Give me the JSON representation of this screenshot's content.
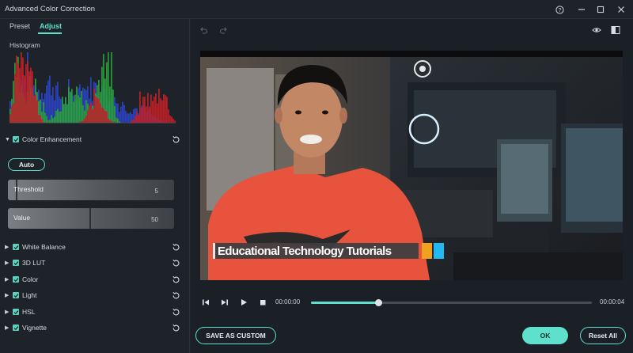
{
  "window": {
    "title": "Advanced Color Correction"
  },
  "tabs": [
    {
      "label": "Preset"
    },
    {
      "label": "Adjust"
    }
  ],
  "histogram": {
    "label": "Histogram"
  },
  "color_enhancement": {
    "label": "Color Enhancement",
    "auto_label": "Auto",
    "threshold": {
      "label": "Threshold",
      "value": "5"
    },
    "value": {
      "label": "Value",
      "value": "50"
    }
  },
  "sections": [
    {
      "label": "White Balance"
    },
    {
      "label": "3D LUT"
    },
    {
      "label": "Color"
    },
    {
      "label": "Light"
    },
    {
      "label": "HSL"
    },
    {
      "label": "Vignette"
    }
  ],
  "preview": {
    "lower_third_text": "Educational Technology Tutorials"
  },
  "playback": {
    "current_time": "00:00:00",
    "end_time": "00:00:04",
    "progress": 0.24
  },
  "buttons": {
    "save_custom": "SAVE AS CUSTOM",
    "ok": "OK",
    "reset_all": "Reset All"
  },
  "colors": {
    "accent": "#5fe0cc",
    "background": "#1e2329"
  }
}
